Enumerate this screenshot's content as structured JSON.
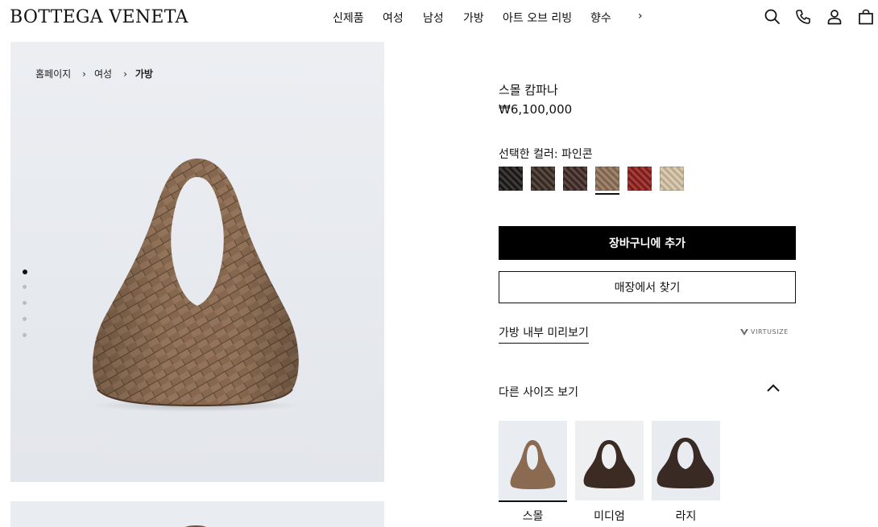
{
  "header": {
    "logo": "BOTTEGA VENETA",
    "nav": [
      "신제품",
      "여성",
      "남성",
      "가방",
      "아트 오브 리빙",
      "향수"
    ],
    "nav_more": "›"
  },
  "breadcrumb": {
    "items": [
      "홈페이지",
      "여성"
    ],
    "current": "가방",
    "separator": "›"
  },
  "gallery": {
    "image_count": 5,
    "active_index": 0
  },
  "product": {
    "name": "스몰 캄파나",
    "price": "₩6,100,000",
    "color_label": "선택한 컬러: 파인콘",
    "swatches": [
      {
        "name": "black",
        "color": "#1d1a19"
      },
      {
        "name": "dark-brown",
        "color": "#3a2c23"
      },
      {
        "name": "fondant",
        "color": "#402a25"
      },
      {
        "name": "pinecone",
        "color": "#8e6f56",
        "selected": true
      },
      {
        "name": "red",
        "color": "#8f1f1b"
      },
      {
        "name": "beige",
        "color": "#d3c1a4"
      }
    ]
  },
  "actions": {
    "add_to_cart": "장바구니에 추가",
    "find_in_store": "매장에서 찾기",
    "bag_preview": "가방 내부 미리보기",
    "virtusize": "VIRTUSIZE"
  },
  "sizes": {
    "title": "다른 사이즈 보기",
    "items": [
      {
        "label": "스몰",
        "bag_color": "#8a6a50",
        "bg": "#e9ecf1",
        "selected": true
      },
      {
        "label": "미디엄",
        "bag_color": "#3b2b22",
        "bg": "#edeff1",
        "selected": false
      },
      {
        "label": "라지",
        "bag_color": "#3a2a24",
        "bg": "#e8ebef",
        "selected": false
      }
    ]
  },
  "colors": {
    "bag_main": "#86684f",
    "bag_dark": "#5e4634",
    "bag_light": "#a3866c"
  }
}
